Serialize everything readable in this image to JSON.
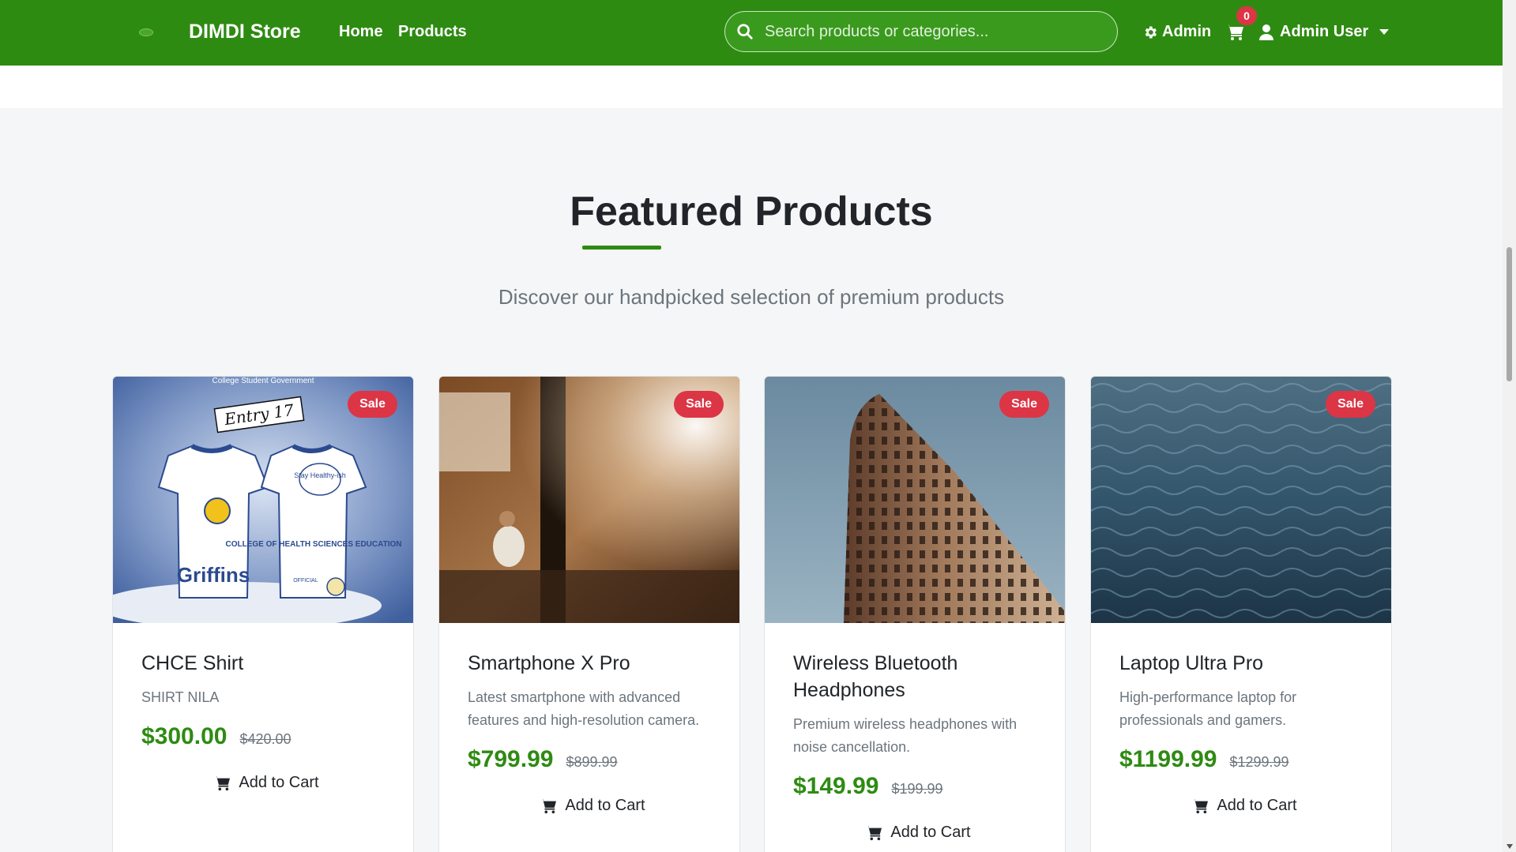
{
  "navbar": {
    "brand": "DIMDI Store",
    "links": [
      "Home",
      "Products"
    ],
    "search_placeholder": "Search products or categories...",
    "admin_label": "Admin",
    "cart_count": "0",
    "user_label": "Admin User"
  },
  "section": {
    "title": "Featured Products",
    "subtitle": "Discover our handpicked selection of premium products"
  },
  "products": [
    {
      "name": "CHCE Shirt",
      "description": "SHIRT NILA",
      "price": "$300.00",
      "old_price": "$420.00",
      "badge": "Sale",
      "add_label": "Add to Cart",
      "image_text": {
        "header": "College Student Government",
        "entry": "Entry 17",
        "bubble": "Stay Healthy-ish",
        "shirt_text": "Griffins",
        "back_text": "COLLEGE OF HEALTH SCIENCES EDUCATION",
        "footer": "OFFICIAL"
      }
    },
    {
      "name": "Smartphone X Pro",
      "description": "Latest smartphone with advanced features and high-resolution camera.",
      "price": "$799.99",
      "old_price": "$899.99",
      "badge": "Sale",
      "add_label": "Add to Cart"
    },
    {
      "name": "Wireless Bluetooth Headphones",
      "description": "Premium wireless headphones with noise cancellation.",
      "price": "$149.99",
      "old_price": "$199.99",
      "badge": "Sale",
      "add_label": "Add to Cart"
    },
    {
      "name": "Laptop Ultra Pro",
      "description": "High-performance laptop for professionals and gamers.",
      "price": "$1199.99",
      "old_price": "$1299.99",
      "badge": "Sale",
      "add_label": "Add to Cart"
    }
  ],
  "colors": {
    "primary": "#2e8b12",
    "sale": "#dc3545",
    "muted": "#6c757d"
  }
}
